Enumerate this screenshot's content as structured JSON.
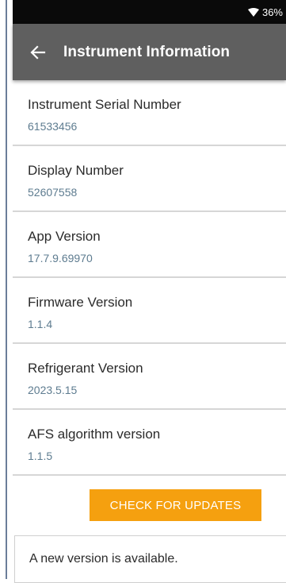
{
  "status_bar": {
    "battery": "36%",
    "wifi_icon": "wifi-icon"
  },
  "app_bar": {
    "back_icon": "arrow-left-icon",
    "title": "Instrument Information"
  },
  "items": [
    {
      "label": "Instrument Serial Number",
      "value": "61533456"
    },
    {
      "label": "Display Number",
      "value": "52607558"
    },
    {
      "label": "App Version",
      "value": "17.7.9.69970"
    },
    {
      "label": "Firmware Version",
      "value": "1.1.4"
    },
    {
      "label": "Refrigerant Version",
      "value": "2023.5.15"
    },
    {
      "label": "AFS algorithm version",
      "value": "1.1.5"
    }
  ],
  "check_button": {
    "label": "CHECK FOR UPDATES",
    "color": "#f5a00f"
  },
  "notice": {
    "text": "A new version is available."
  },
  "colors": {
    "app_bar": "#5f5f5f",
    "value_text": "#5e7c90"
  }
}
